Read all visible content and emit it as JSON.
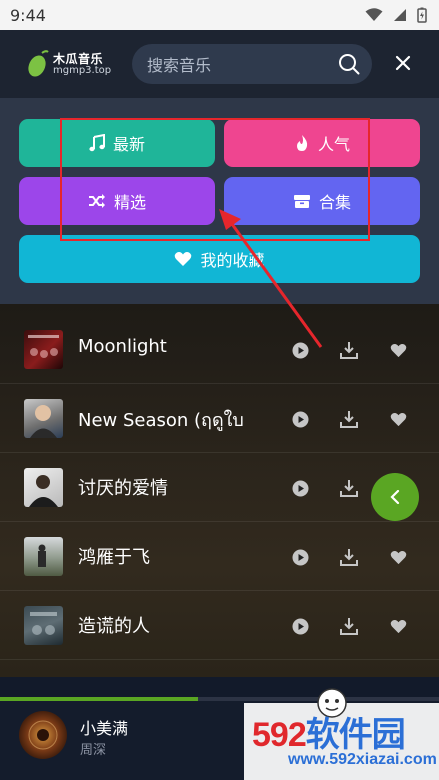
{
  "status_bar": {
    "time": "9:44"
  },
  "header": {
    "brand": "木瓜音乐",
    "domain": "mgmp3.top",
    "search_placeholder": "搜索音乐"
  },
  "categories": {
    "new": "最新",
    "hot": "人气",
    "pick": "精选",
    "collection": "合集",
    "favorites": "我的收藏"
  },
  "songs": [
    {
      "title": "Moonlight"
    },
    {
      "title": "New Season (ฤดูใบ"
    },
    {
      "title": "讨厌的爱情"
    },
    {
      "title": "鸿雁于飞"
    },
    {
      "title": "造谎的人"
    }
  ],
  "player": {
    "title": "小美满",
    "artist": "周深",
    "progress": 0.45
  },
  "watermark": {
    "number": "592",
    "text": "软件园",
    "url": "www.592xiazai.com"
  },
  "colors": {
    "new": "#1fb599",
    "hot": "#ef4590",
    "pick": "#9c46ea",
    "collection": "#6365f1",
    "favorites": "#11b6d5",
    "accent": "#5aa623",
    "annotation": "#e6262c"
  }
}
